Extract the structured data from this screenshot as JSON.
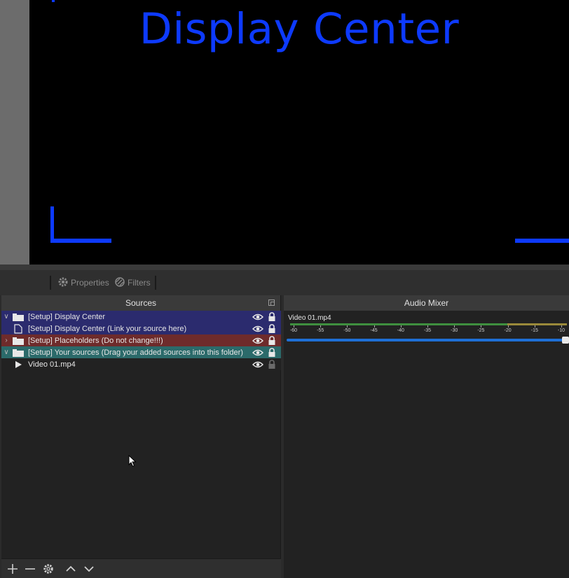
{
  "preview": {
    "title": "Display Center",
    "text_color": "#0d3aff"
  },
  "toolbar": {
    "properties_label": "Properties",
    "filters_label": "Filters"
  },
  "sources_dock": {
    "title": "Sources",
    "items": [
      {
        "label": "[Setup] Display Center",
        "type": "folder",
        "expanded": true,
        "bg": "#2b2b6e",
        "visible": true,
        "locked": true
      },
      {
        "label": "[Setup] Display Center (Link your source here)",
        "type": "file",
        "expanded": false,
        "bg": "#2b2b6e",
        "visible": true,
        "locked": true
      },
      {
        "label": "[Setup] Placeholders (Do not change!!!)",
        "type": "folder",
        "expanded": false,
        "bg": "#6e2b2b",
        "visible": true,
        "locked": true
      },
      {
        "label": "[Setup] Your sources (Drag your added sources into this folder)",
        "type": "folder",
        "expanded": true,
        "bg": "#2b6a6a",
        "visible": true,
        "locked": true
      },
      {
        "label": "Video 01.mp4",
        "type": "media",
        "expanded": false,
        "bg": "#222222",
        "visible": true,
        "locked": false
      }
    ]
  },
  "mixer_dock": {
    "title": "Audio Mixer",
    "channel_label": "Video 01.mp4",
    "tick_labels": [
      "-60",
      "-55",
      "-50",
      "-45",
      "-40",
      "-35",
      "-30",
      "-25",
      "-20",
      "-15",
      "-10"
    ],
    "volume_level": 1.0,
    "meter_color": "#3f8f3f",
    "slider_color": "#1e6fd6"
  },
  "footer_icons": [
    "add-icon",
    "remove-icon",
    "gear-icon",
    "move-up-icon",
    "move-down-icon"
  ]
}
